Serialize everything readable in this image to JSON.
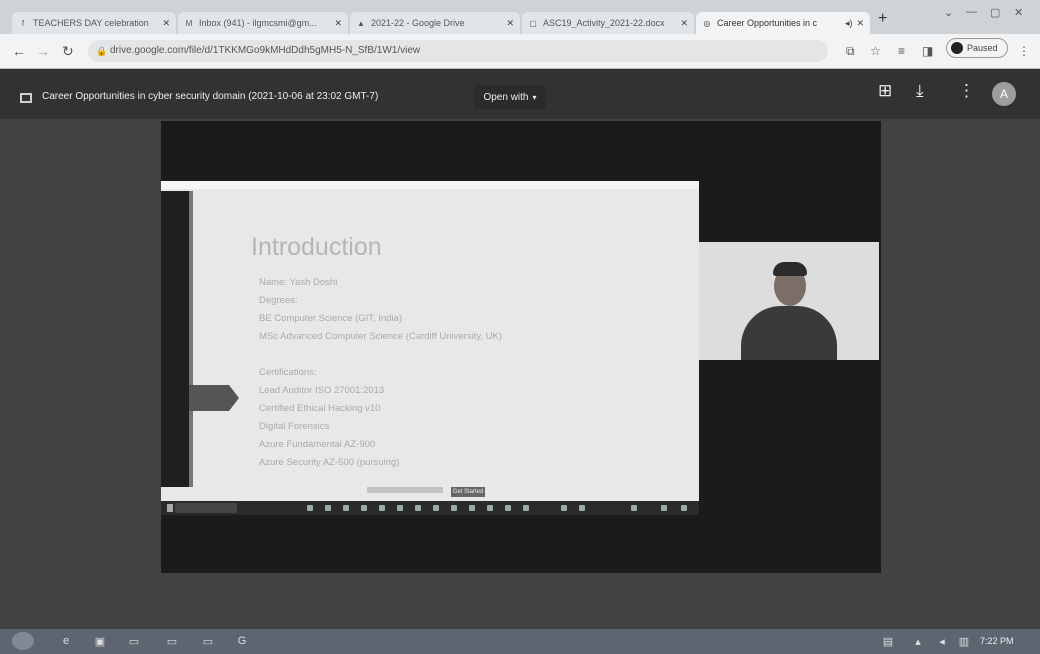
{
  "browser": {
    "tabs": [
      {
        "title": "TEACHERS DAY celebration",
        "favicon": "facebook-icon",
        "active": false
      },
      {
        "title": "Inbox (941) - ilgmcsmi@gm...",
        "favicon": "gmail-icon",
        "active": false
      },
      {
        "title": "2021-22 - Google Drive",
        "favicon": "drive-icon",
        "active": false
      },
      {
        "title": "ASC19_Activity_2021-22.docx",
        "favicon": "doc-icon",
        "active": false
      },
      {
        "title": "Career Opportunities in c",
        "favicon": "globe-icon",
        "active": true
      }
    ],
    "new_tab": "+",
    "url": "drive.google.com/file/d/1TKKMGo9kMHdDdh5gMH5-N_SfB/1W1/view",
    "profile_label": "Paused"
  },
  "viewer": {
    "title": "Career Opportunities in cyber security domain (2021-10-06 at 23:02 GMT-7)",
    "open_with": "Open with",
    "avatar_letter": "A"
  },
  "slide": {
    "title": "Introduction",
    "lines": [
      "Name: Yash Doshi",
      "Degrees:",
      "BE Computer Science (GIT, India)",
      "MSc Advanced Computer Science (Cardiff University, UK)",
      "",
      "Certifications:",
      "Lead Auditor ISO 27001:2013",
      "Certified Ethical Hacking v10",
      "Digital Forensics",
      "Azure Fundamental AZ-900",
      "Azure Security AZ-500 (pursuing)"
    ],
    "button_label": "Get Started"
  },
  "taskbar": {
    "clock": "7:22 PM"
  }
}
